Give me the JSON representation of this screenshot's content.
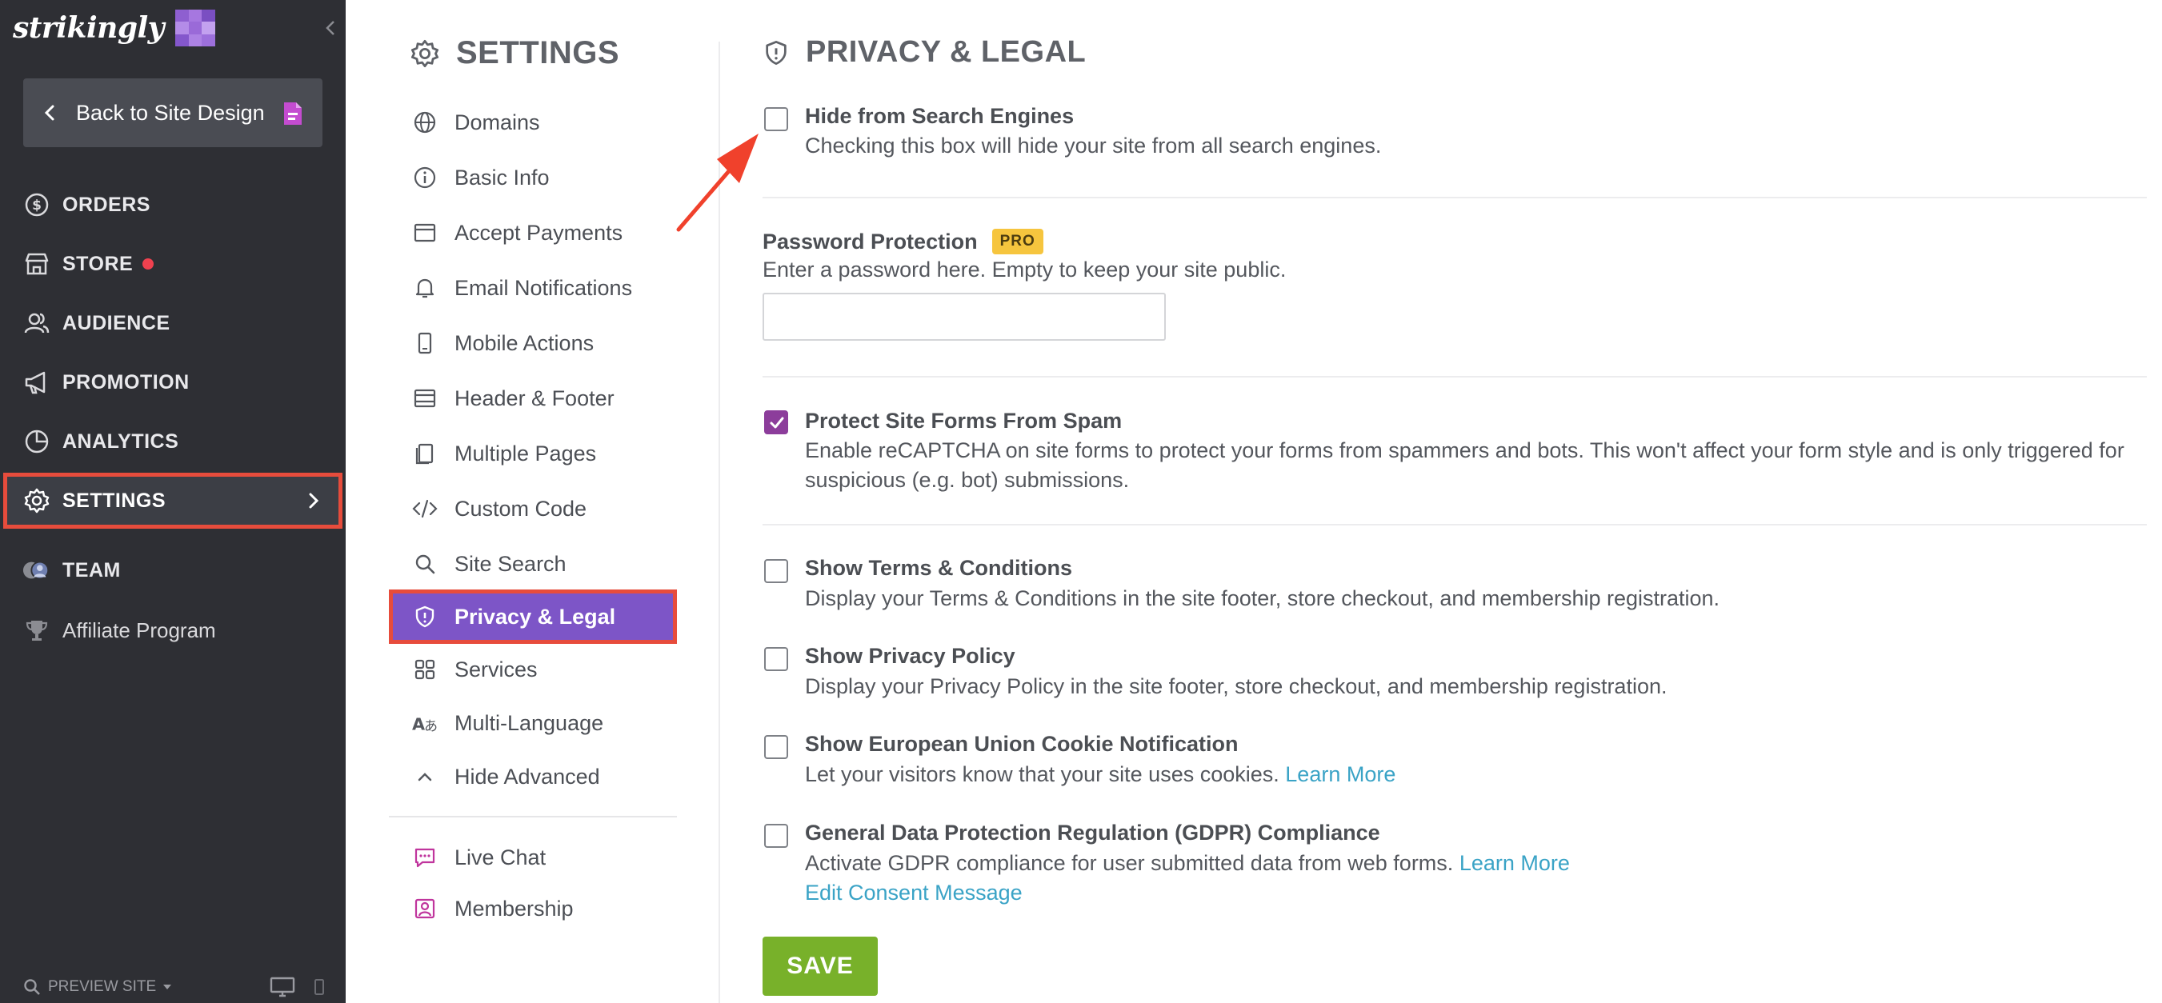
{
  "sidebar": {
    "brand": "strikingly",
    "back_label": "Back to Site Design",
    "items": [
      {
        "label": "ORDERS",
        "icon": "dollar-circle-icon"
      },
      {
        "label": "STORE",
        "icon": "store-icon",
        "badge_color": "#f0414f"
      },
      {
        "label": "AUDIENCE",
        "icon": "users-icon"
      },
      {
        "label": "PROMOTION",
        "icon": "megaphone-icon"
      },
      {
        "label": "ANALYTICS",
        "icon": "pie-chart-icon"
      },
      {
        "label": "SETTINGS",
        "icon": "gear-icon",
        "active": true
      },
      {
        "label": "TEAM",
        "icon": "team-avatars-icon"
      },
      {
        "label": "Affiliate Program",
        "icon": "trophy-icon"
      }
    ],
    "bottom": {
      "preview_label": "PREVIEW SITE"
    }
  },
  "settings_nav": {
    "title": "SETTINGS",
    "items": [
      {
        "label": "Domains",
        "icon": "globe-icon"
      },
      {
        "label": "Basic Info",
        "icon": "info-icon"
      },
      {
        "label": "Accept Payments",
        "icon": "payment-card-icon"
      },
      {
        "label": "Email Notifications",
        "icon": "bell-icon"
      },
      {
        "label": "Mobile Actions",
        "icon": "mobile-icon"
      },
      {
        "label": "Header & Footer",
        "icon": "header-footer-icon"
      },
      {
        "label": "Multiple Pages",
        "icon": "pages-icon"
      },
      {
        "label": "Custom Code",
        "icon": "code-icon"
      },
      {
        "label": "Site Search",
        "icon": "search-icon"
      },
      {
        "label": "Privacy & Legal",
        "icon": "shield-icon",
        "active": true
      },
      {
        "label": "Services",
        "icon": "grid-icon"
      },
      {
        "label": "Multi-Language",
        "icon": "translate-icon"
      },
      {
        "label": "Hide Advanced",
        "icon": "chevron-up-icon"
      }
    ],
    "extras": [
      {
        "label": "Live Chat",
        "icon": "chat-icon"
      },
      {
        "label": "Membership",
        "icon": "member-icon"
      }
    ]
  },
  "privacy": {
    "title": "PRIVACY & LEGAL",
    "hide_search": {
      "title": "Hide from Search Engines",
      "desc": "Checking this box will hide your site from all search engines.",
      "checked": false
    },
    "password": {
      "label": "Password Protection",
      "badge": "PRO",
      "desc": "Enter a password here. Empty to keep your site public.",
      "value": ""
    },
    "spam": {
      "title": "Protect Site Forms From Spam",
      "desc": "Enable reCAPTCHA on site forms to protect your forms from spammers and bots. This won't affect your form style and is only triggered for suspicious (e.g. bot) submissions.",
      "checked": true
    },
    "terms": {
      "title": "Show Terms & Conditions",
      "desc": "Display your Terms & Conditions in the site footer, store checkout, and membership registration.",
      "checked": false
    },
    "privacy_policy": {
      "title": "Show Privacy Policy",
      "desc": "Display your Privacy Policy in the site footer, store checkout, and membership registration.",
      "checked": false
    },
    "cookie": {
      "title": "Show European Union Cookie Notification",
      "desc": "Let your visitors know that your site uses cookies.",
      "link": "Learn More",
      "checked": false
    },
    "gdpr": {
      "title": "General Data Protection Regulation (GDPR) Compliance",
      "desc": "Activate GDPR compliance for user submitted data from web forms.",
      "link": "Learn More",
      "link2": "Edit Consent Message",
      "checked": false
    },
    "save_label": "SAVE"
  },
  "colors": {
    "accent": "#7d55c7",
    "highlight": "#e74c3c",
    "save": "#78b12a",
    "link": "#3aa3c6",
    "checkbox_checked": "#8c3d9b",
    "pro_badge": "#f6c53e"
  }
}
